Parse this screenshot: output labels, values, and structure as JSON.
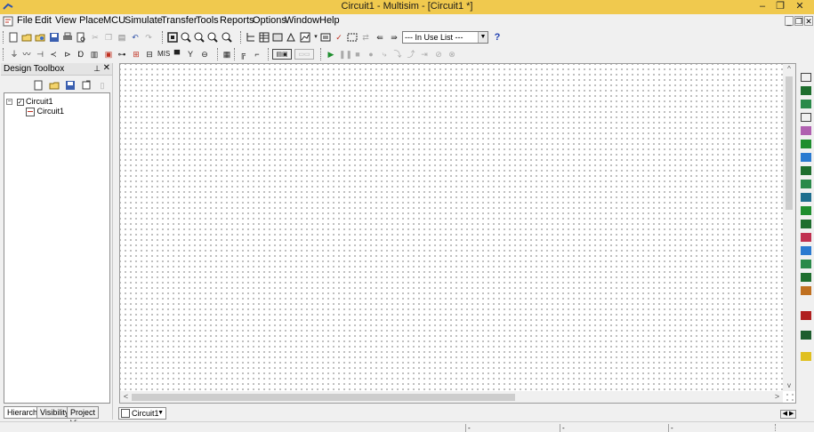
{
  "window": {
    "title": "Circuit1 - Multisim - [Circuit1 *]",
    "controls": {
      "minimize": "–",
      "restore": "❐",
      "close": "✕"
    }
  },
  "menu": {
    "items": [
      "File",
      "Edit",
      "View",
      "Place",
      "MCU",
      "Simulate",
      "Transfer",
      "Tools",
      "Reports",
      "Options",
      "Window",
      "Help"
    ],
    "mdi_controls": {
      "minimize": "_",
      "restore": "❐",
      "close": "✕"
    }
  },
  "toolbar": {
    "in_use_list": "--- In Use List ---",
    "help_label": "?"
  },
  "design_toolbox": {
    "title": "Design Toolbox",
    "pin_label": "⊥",
    "close_label": "✕",
    "tree": {
      "root": "Circuit1",
      "child": "Circuit1"
    },
    "tabs": [
      "Hierarchy",
      "Visibility",
      "Project View"
    ]
  },
  "document_tab": {
    "label": "Circuit1",
    "dropdown": "▼"
  },
  "tab_navigation": "◀ ▶",
  "scroll_arrows": {
    "up": "^",
    "down": "v",
    "left": "<",
    "right": ">"
  },
  "status_bar": {
    "cells": [
      "-",
      "-",
      "-"
    ]
  },
  "colors": {
    "titlebar": "#f0c94e",
    "workspace": "#ffffff",
    "grid_dot": "#000000",
    "run_green": "#1e8e2e",
    "help_blue": "#1f3fb0"
  },
  "icons": {
    "app": "multisim-app-icon",
    "document": "circuit-document-icon",
    "run": "play-icon",
    "pause": "pause-icon",
    "stop": "stop-icon"
  }
}
